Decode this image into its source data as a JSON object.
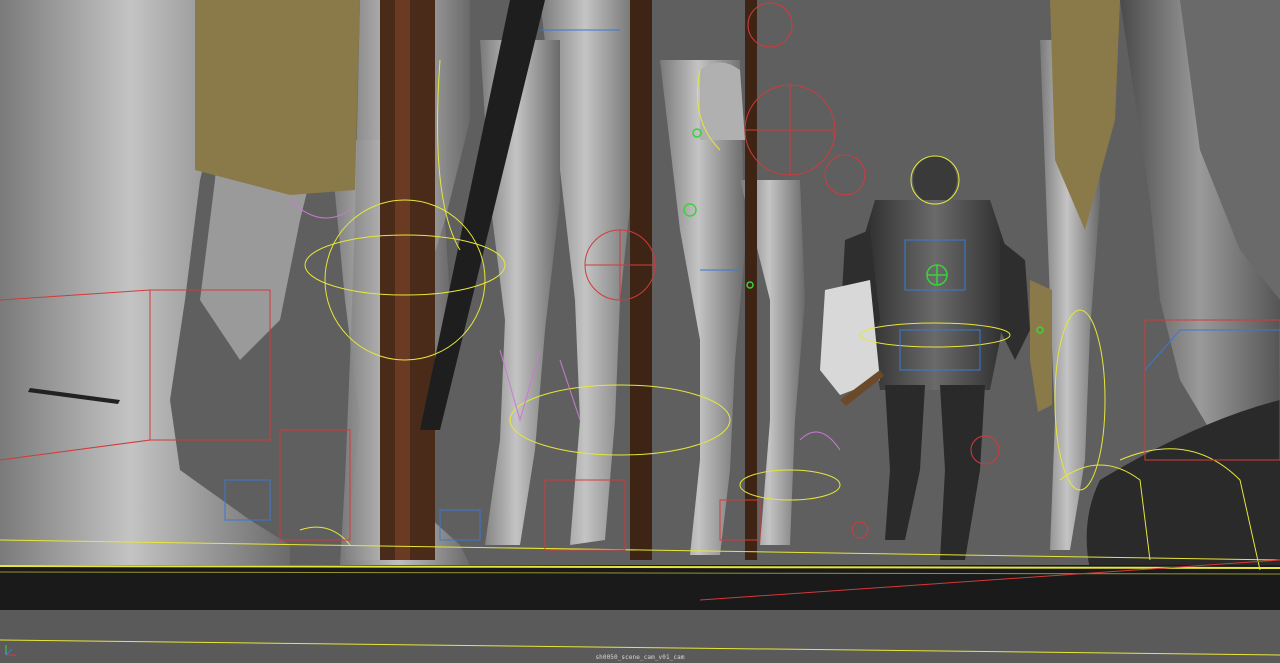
{
  "viewport": {
    "camera_label": "sh0050_scene_cam_v01_cam"
  },
  "colors": {
    "background": "#5f5f5f",
    "skin": "#b4b4b4",
    "armor": "#3a3a3a",
    "pole": "#4a2a18",
    "shield": "#8a7a4a",
    "ground": "#1a1a1a",
    "rig_yellow": "#e6e63a",
    "rig_red": "#d23a3a",
    "rig_blue": "#3a7ad2",
    "rig_green": "#3ad23a"
  },
  "icons": {
    "axis_gizmo": "axis-gizmo-icon"
  }
}
